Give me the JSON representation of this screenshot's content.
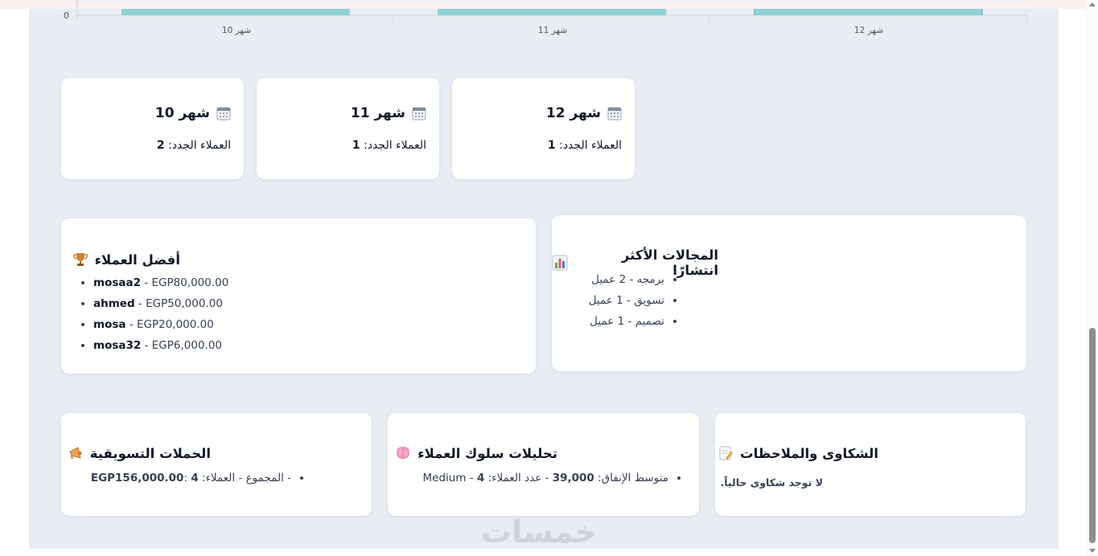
{
  "chart": {
    "y_tick": "0",
    "x_labels": [
      "شهر 10",
      "شهر 11",
      "شهر 12"
    ],
    "bar_color": "#8fd3d6"
  },
  "months": [
    {
      "title": "شهر 12",
      "label": "العملاء الجدد:",
      "value": "1"
    },
    {
      "title": "شهر 11",
      "label": "العملاء الجدد:",
      "value": "1"
    },
    {
      "title": "شهر 10",
      "label": "العملاء الجدد:",
      "value": "2"
    }
  ],
  "fields": {
    "title": "المجالات الأكثر انتشارًا",
    "icon": "bar-chart-icon",
    "items": [
      "برمجه - 2 عميل",
      "تسويق - 1 عميل",
      "تصميم - 1 عميل"
    ]
  },
  "top_clients": {
    "title": "أفضل العملاء",
    "icon": "trophy-icon",
    "items": [
      {
        "name": "mosaa2",
        "amount": "EGP80,000.00"
      },
      {
        "name": "ahmed",
        "amount": "EGP50,000.00"
      },
      {
        "name": "mosa",
        "amount": "EGP20,000.00"
      },
      {
        "name": "mosa32",
        "amount": "EGP6,000.00"
      }
    ]
  },
  "complaints": {
    "title": "الشكاوى والملاحظات",
    "icon": "memo-icon",
    "text": "لا توجد شكاوى حالياً."
  },
  "behavior": {
    "title": "تحليلات سلوك العملاء",
    "icon": "brain-icon",
    "avg_label": "متوسط الإنفاق:",
    "avg_value": "39,000",
    "count_label": "- عدد العملاء:",
    "count_value": "4",
    "segment": "- Medium"
  },
  "campaigns": {
    "title": "الحملات التسويقية",
    "icon": "megaphone-icon",
    "prefix": "- المجموع",
    "clients_label": "- العملاء:",
    "clients_value": "4",
    "total_label": ":",
    "total_value": "EGP156,000.00"
  },
  "watermark": "خمسات"
}
